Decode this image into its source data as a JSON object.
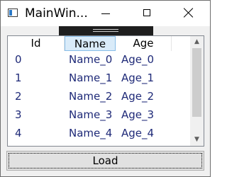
{
  "window": {
    "title": "MainWin..."
  },
  "grid": {
    "columns": [
      "Id",
      "Name",
      "Age"
    ],
    "rows": [
      [
        "0",
        "Name_0",
        "Age_0"
      ],
      [
        "1",
        "Name_1",
        "Age_1"
      ],
      [
        "2",
        "Name_2",
        "Age_2"
      ],
      [
        "3",
        "Name_3",
        "Age_3"
      ],
      [
        "4",
        "Name_4",
        "Age_4"
      ]
    ],
    "scroll_up_icon": "▲",
    "scroll_down_icon": "▼"
  },
  "actions": {
    "load_label": "Load"
  },
  "colors": {
    "cell_text": "#1f2a78",
    "header_selected": "#d9ebf9",
    "debug_toolbar": "#1e1e1e"
  }
}
